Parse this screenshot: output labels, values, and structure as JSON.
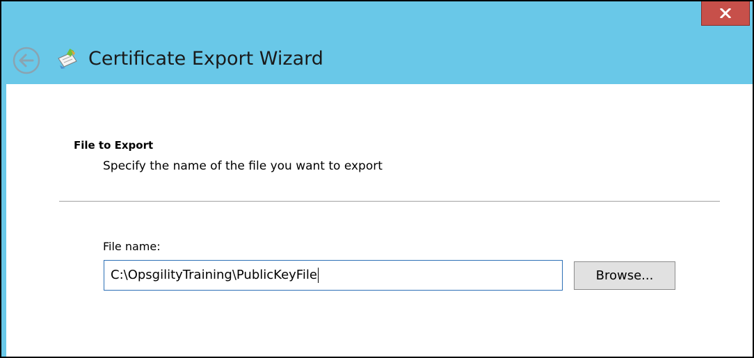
{
  "window": {
    "title": "Certificate Export Wizard",
    "accent_color": "#69c8e8",
    "close_color": "#c7504a"
  },
  "titlebar": {
    "close_icon": "close-icon",
    "back_icon": "back-arrow-icon",
    "wizard_icon": "certificate-wizard-icon"
  },
  "page": {
    "heading": "File to Export",
    "description": "Specify the name of the file you want to export"
  },
  "form": {
    "file_name_label": "File name:",
    "file_name_value": "C:\\OpsgilityTraining\\PublicKeyFile",
    "browse_label": "Browse..."
  }
}
